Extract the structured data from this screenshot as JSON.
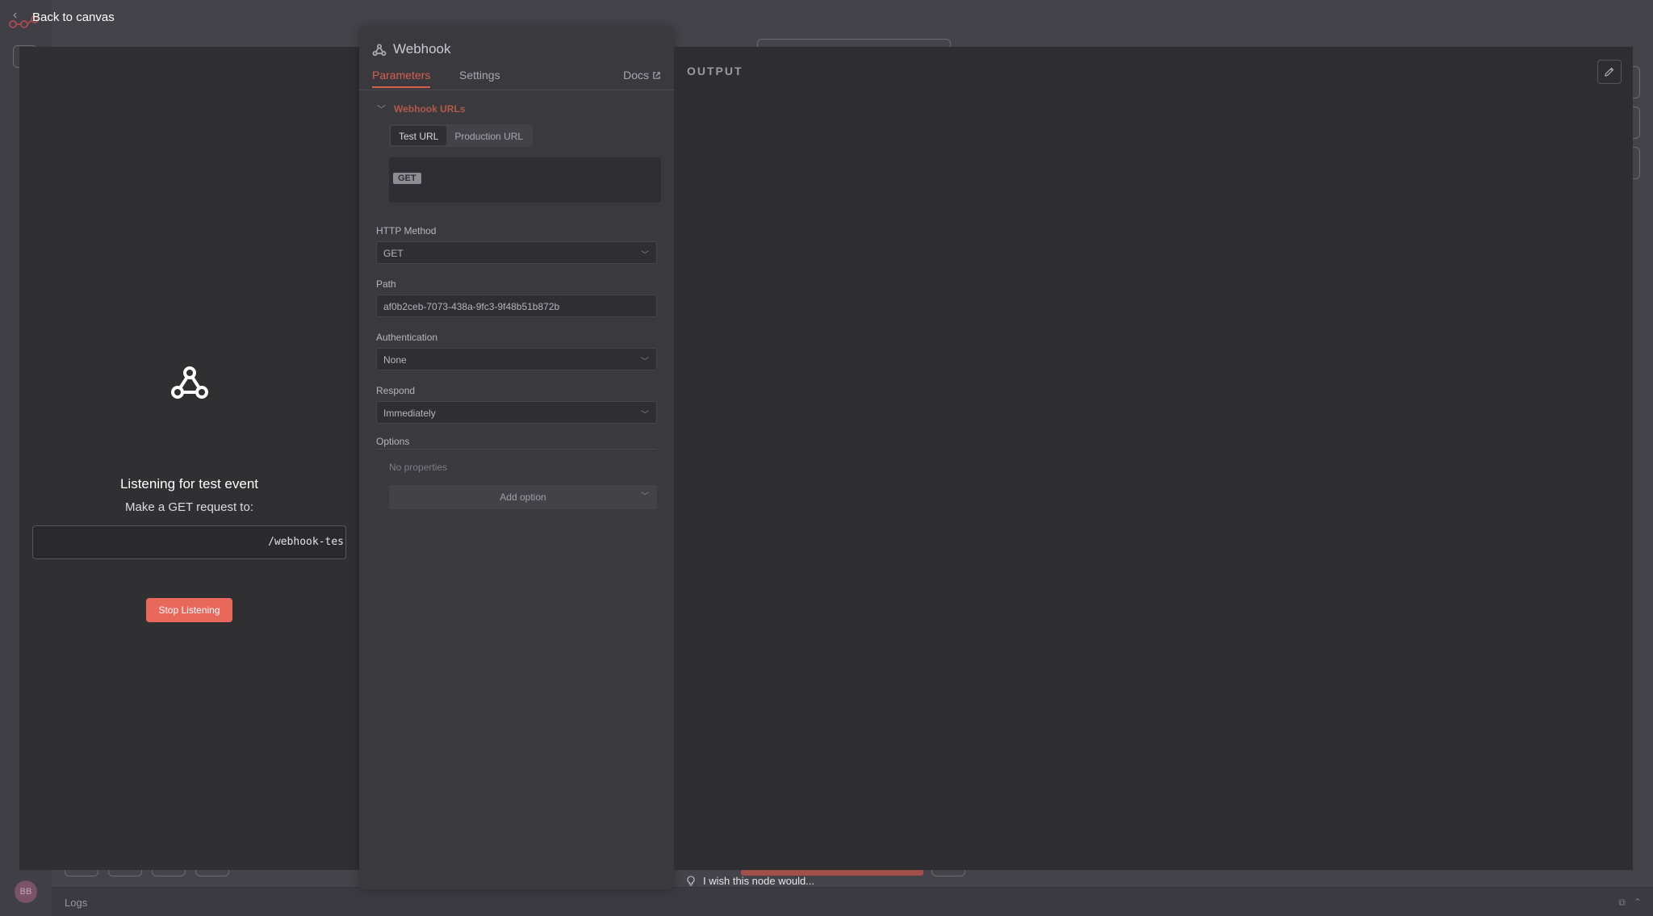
{
  "nav": {
    "back_label": "Back to canvas"
  },
  "input_panel": {
    "title": "Listening for test event",
    "subtitle": "Make a GET request to:",
    "url": "/webhook-tes",
    "stop_label": "Stop Listening"
  },
  "node": {
    "title": "Webhook",
    "tabs": {
      "parameters": "Parameters",
      "settings": "Settings",
      "docs": "Docs"
    },
    "webhook_urls_label": "Webhook URLs",
    "url_tabs": {
      "test": "Test URL",
      "production": "Production URL"
    },
    "url_method": "GET",
    "fields": {
      "http_method": {
        "label": "HTTP Method",
        "value": "GET"
      },
      "path": {
        "label": "Path",
        "value": "af0b2ceb-7073-438a-9fc3-9f48b51b872b"
      },
      "authentication": {
        "label": "Authentication",
        "value": "None"
      },
      "respond": {
        "label": "Respond",
        "value": "Immediately"
      }
    },
    "options": {
      "label": "Options",
      "empty_text": "No properties",
      "add_label": "Add option"
    }
  },
  "output": {
    "label": "OUTPUT"
  },
  "footer": {
    "logs_label": "Logs",
    "wish_label": "I wish this node would...",
    "avatar_initials": "BB"
  },
  "colors": {
    "accent": "#e8685c",
    "tab_active": "#d3604f"
  },
  "icons": [
    "webhook-icon",
    "external-link-icon",
    "chevron-down-icon",
    "pencil-icon",
    "lightbulb-icon",
    "arrow-left-icon"
  ]
}
